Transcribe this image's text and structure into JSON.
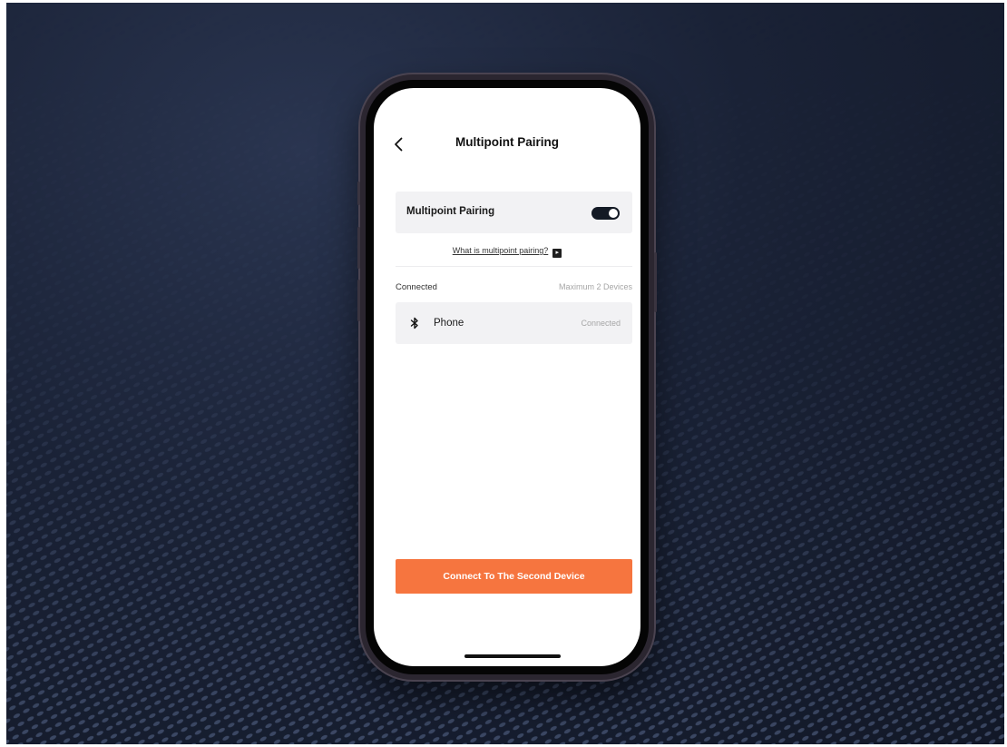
{
  "nav": {
    "title": "Multipoint Pairing"
  },
  "multipoint": {
    "label": "Multipoint Pairing",
    "enabled": true,
    "help_link": "What is multipoint pairing?"
  },
  "connected_section": {
    "heading": "Connected",
    "limit_note": "Maximum 2 Devices",
    "devices": [
      {
        "icon": "bluetooth-icon",
        "name": "Phone",
        "status": "Connected"
      }
    ]
  },
  "cta": {
    "label": "Connect To The Second Device"
  },
  "colors": {
    "accent": "#f6753f",
    "toggle_on": "#141a25",
    "card_bg": "#f2f2f4"
  }
}
